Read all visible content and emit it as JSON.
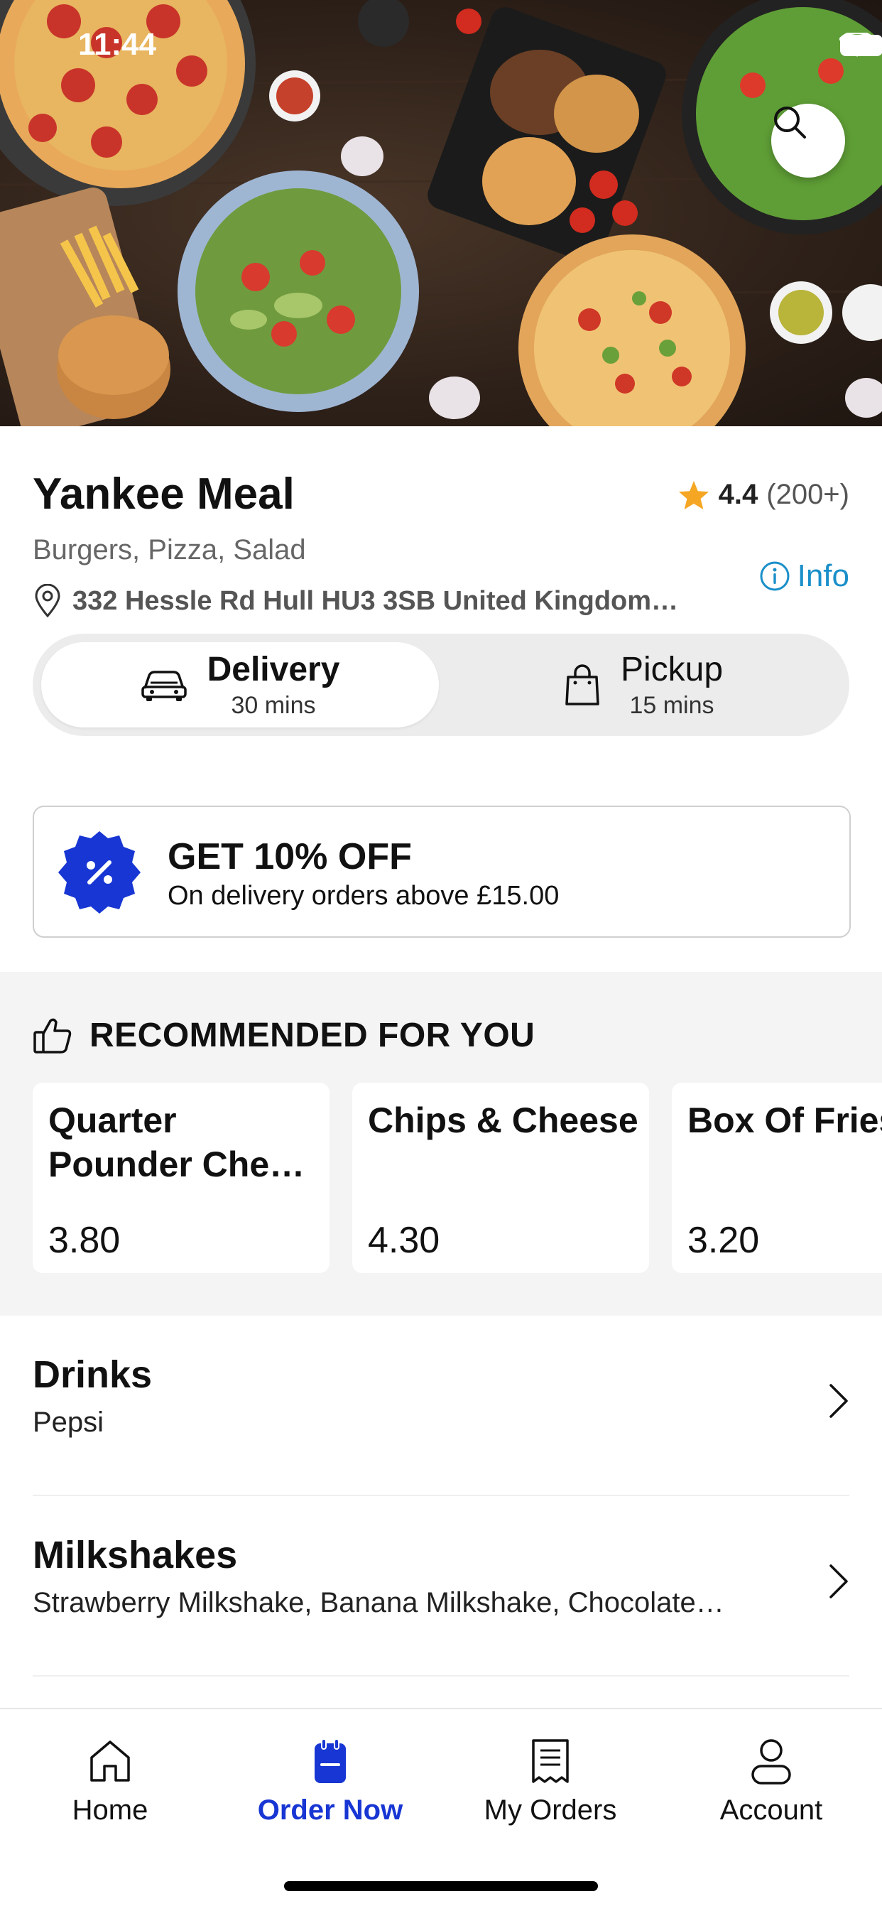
{
  "status_bar": {
    "time": "11:44"
  },
  "restaurant": {
    "name": "Yankee Meal",
    "rating": "4.4",
    "rating_count": "(200+)",
    "cuisines": "Burgers, Pizza, Salad",
    "address": "332 Hessle Rd Hull HU3 3SB United Kingdom…",
    "info_label": "Info"
  },
  "fulfillment": {
    "options": [
      {
        "label": "Delivery",
        "time": "30 mins",
        "icon": "car-icon",
        "selected": true
      },
      {
        "label": "Pickup",
        "time": "15 mins",
        "icon": "shopping-bag-icon",
        "selected": false
      }
    ]
  },
  "offer": {
    "title": "GET 10% OFF",
    "subtitle": "On delivery orders above £15.00",
    "icon": "percent-badge-icon"
  },
  "recommended": {
    "title": "RECOMMENDED FOR YOU",
    "icon": "thumbs-up-icon",
    "items": [
      {
        "name": "Quarter\nPounder Che…",
        "price": "3.80"
      },
      {
        "name": "Chips & Cheese",
        "price": "4.30"
      },
      {
        "name": "Box Of Fries",
        "price": "3.20"
      }
    ]
  },
  "categories": [
    {
      "title": "Drinks",
      "items": "Pepsi"
    },
    {
      "title": "Milkshakes",
      "items": "Strawberry Milkshake, Banana Milkshake, Chocolate…"
    }
  ],
  "bottom_nav": {
    "items": [
      {
        "label": "Home",
        "icon": "home-icon",
        "active": false
      },
      {
        "label": "Order Now",
        "icon": "order-icon",
        "active": true
      },
      {
        "label": "My Orders",
        "icon": "receipt-icon",
        "active": false
      },
      {
        "label": "Account",
        "icon": "user-icon",
        "active": false
      }
    ]
  },
  "colors": {
    "accent": "#1736d3",
    "info": "#1a8fc9",
    "star": "#f5a623",
    "section_bg": "#f4f4f4"
  }
}
